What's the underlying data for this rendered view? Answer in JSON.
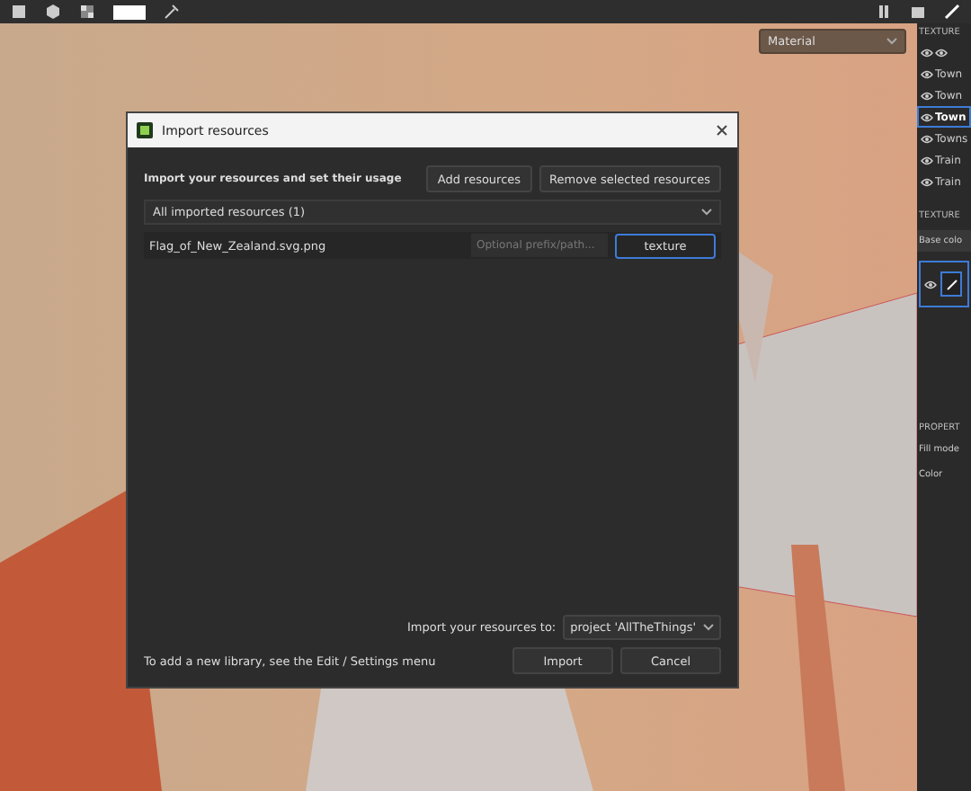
{
  "viewport": {
    "mode_select": "Material"
  },
  "dialog": {
    "title": "Import resources",
    "heading": "Import your resources and set their usage",
    "buttons_top": [
      "Add resources",
      "Remove selected resources"
    ],
    "filter": "All imported resources (1)",
    "resources": [
      {
        "name": "Flag_of_New_Zealand.svg.png",
        "prefix_placeholder": "Optional prefix/path...",
        "usage": "texture",
        "selected": true
      }
    ],
    "destination_label": "Import your resources to:",
    "destination": "project 'AllTheThings'",
    "hint": "To add a new library, see the Edit / Settings menu",
    "buttons_bottom": [
      "Import",
      "Cancel"
    ]
  },
  "side_panel": {
    "texture_sets_title": "TEXTURE",
    "texture_sets": [
      {
        "label": "Town",
        "selected": false
      },
      {
        "label": "Town",
        "selected": false
      },
      {
        "label": "Town",
        "selected": true
      },
      {
        "label": "Towns",
        "selected": false
      },
      {
        "label": "Train",
        "selected": false
      },
      {
        "label": "Train",
        "selected": false
      }
    ],
    "layers_title": "TEXTURE",
    "channel": "Base colo",
    "properties_title": "PROPERT",
    "properties": [
      "Fill mode",
      "Color"
    ]
  }
}
